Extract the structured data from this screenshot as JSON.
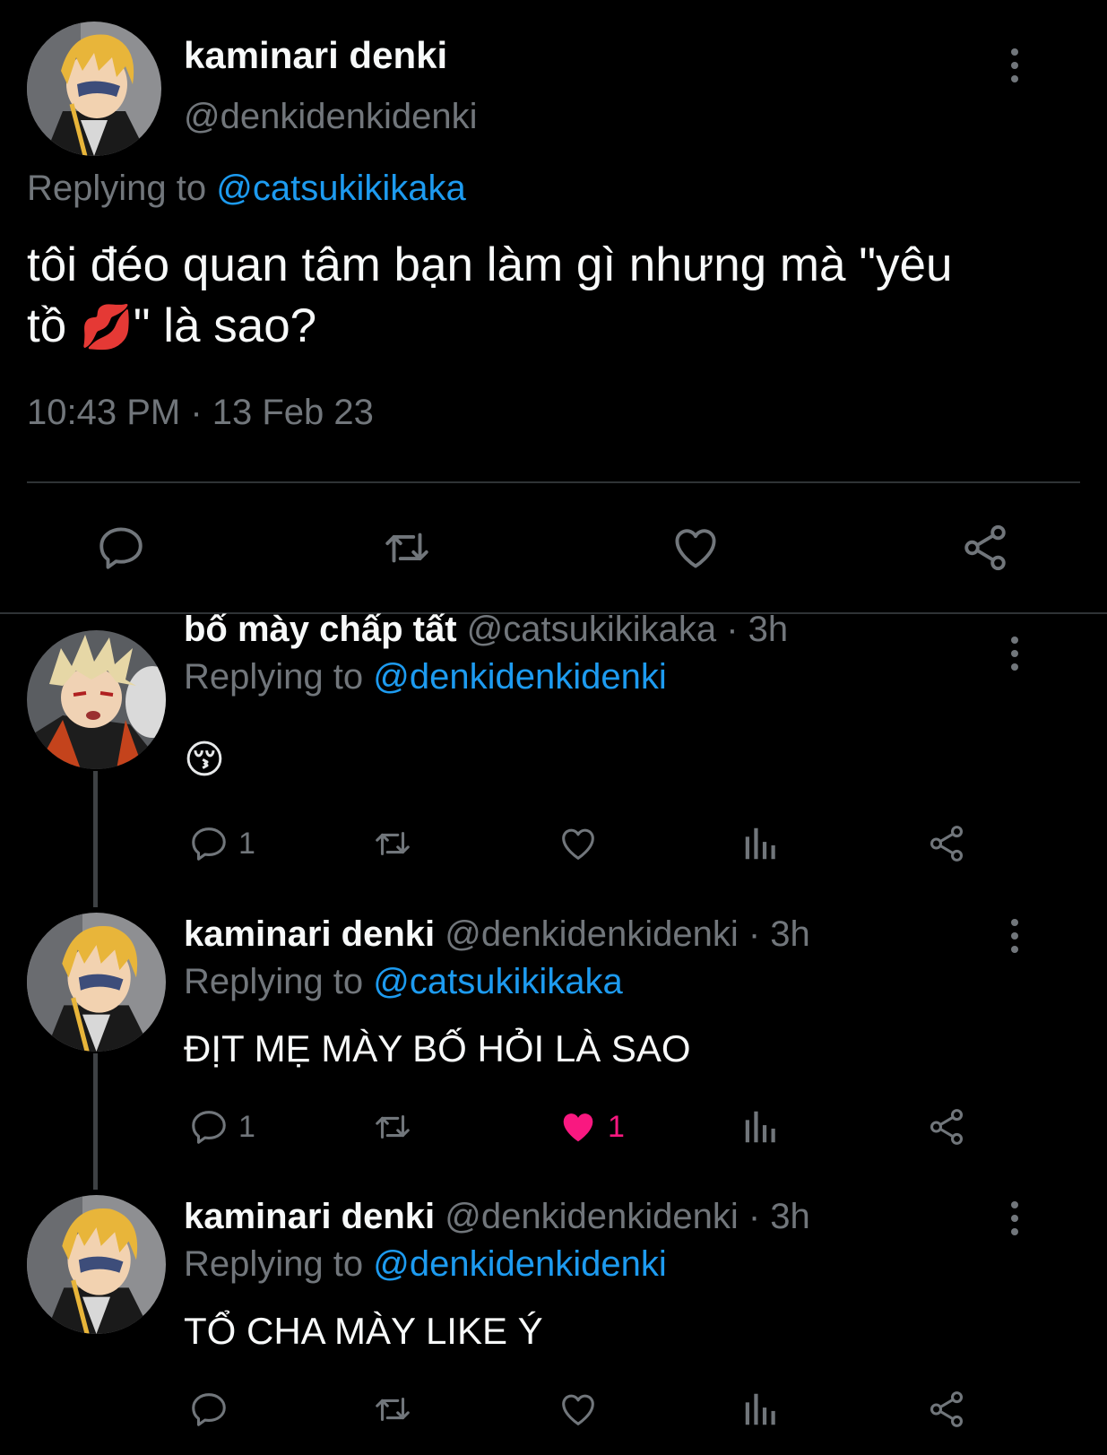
{
  "main_tweet": {
    "display_name": "kaminari denki",
    "handle": "@denkidenkidenki",
    "replying_label": "Replying to",
    "replying_to": "@catsukikikaka",
    "text_line1": "tôi đéo quan tâm bạn làm gì nhưng mà \"yêu",
    "text_line2_a": "tồ",
    "text_line2_emoji": "💋",
    "text_line2_b": "\" là sao?",
    "timestamp": "10:43 PM · 13 Feb 23"
  },
  "replies": [
    {
      "display_name": "bố mày chấp tất",
      "handle": "@catsukikikaka",
      "time": "· 3h",
      "replying_label": "Replying to",
      "replying_to": "@denkidenkidenki",
      "text": "😚",
      "reply_count": "1",
      "like_count": "",
      "liked": false
    },
    {
      "display_name": "kaminari denki",
      "handle": "@denkidenkidenki",
      "time": "· 3h",
      "replying_label": "Replying to",
      "replying_to": "@catsukikikaka",
      "text": "ĐỊT MẸ MÀY BỐ HỎI LÀ SAO",
      "reply_count": "1",
      "like_count": "1",
      "liked": true
    },
    {
      "display_name": "kaminari denki",
      "handle": "@denkidenkidenki",
      "time": "· 3h",
      "replying_label": "Replying to",
      "replying_to": "@denkidenkidenki",
      "text": "TỔ CHA MÀY LIKE Ý",
      "reply_count": "",
      "like_count": "",
      "liked": false
    }
  ],
  "colors": {
    "background": "#000000",
    "text": "#e7e9ea",
    "muted": "#71767b",
    "link": "#1d9bf0",
    "like": "#f91880"
  },
  "icons": [
    "reply-icon",
    "retweet-icon",
    "like-icon",
    "share-icon",
    "analytics-icon",
    "more-icon"
  ]
}
